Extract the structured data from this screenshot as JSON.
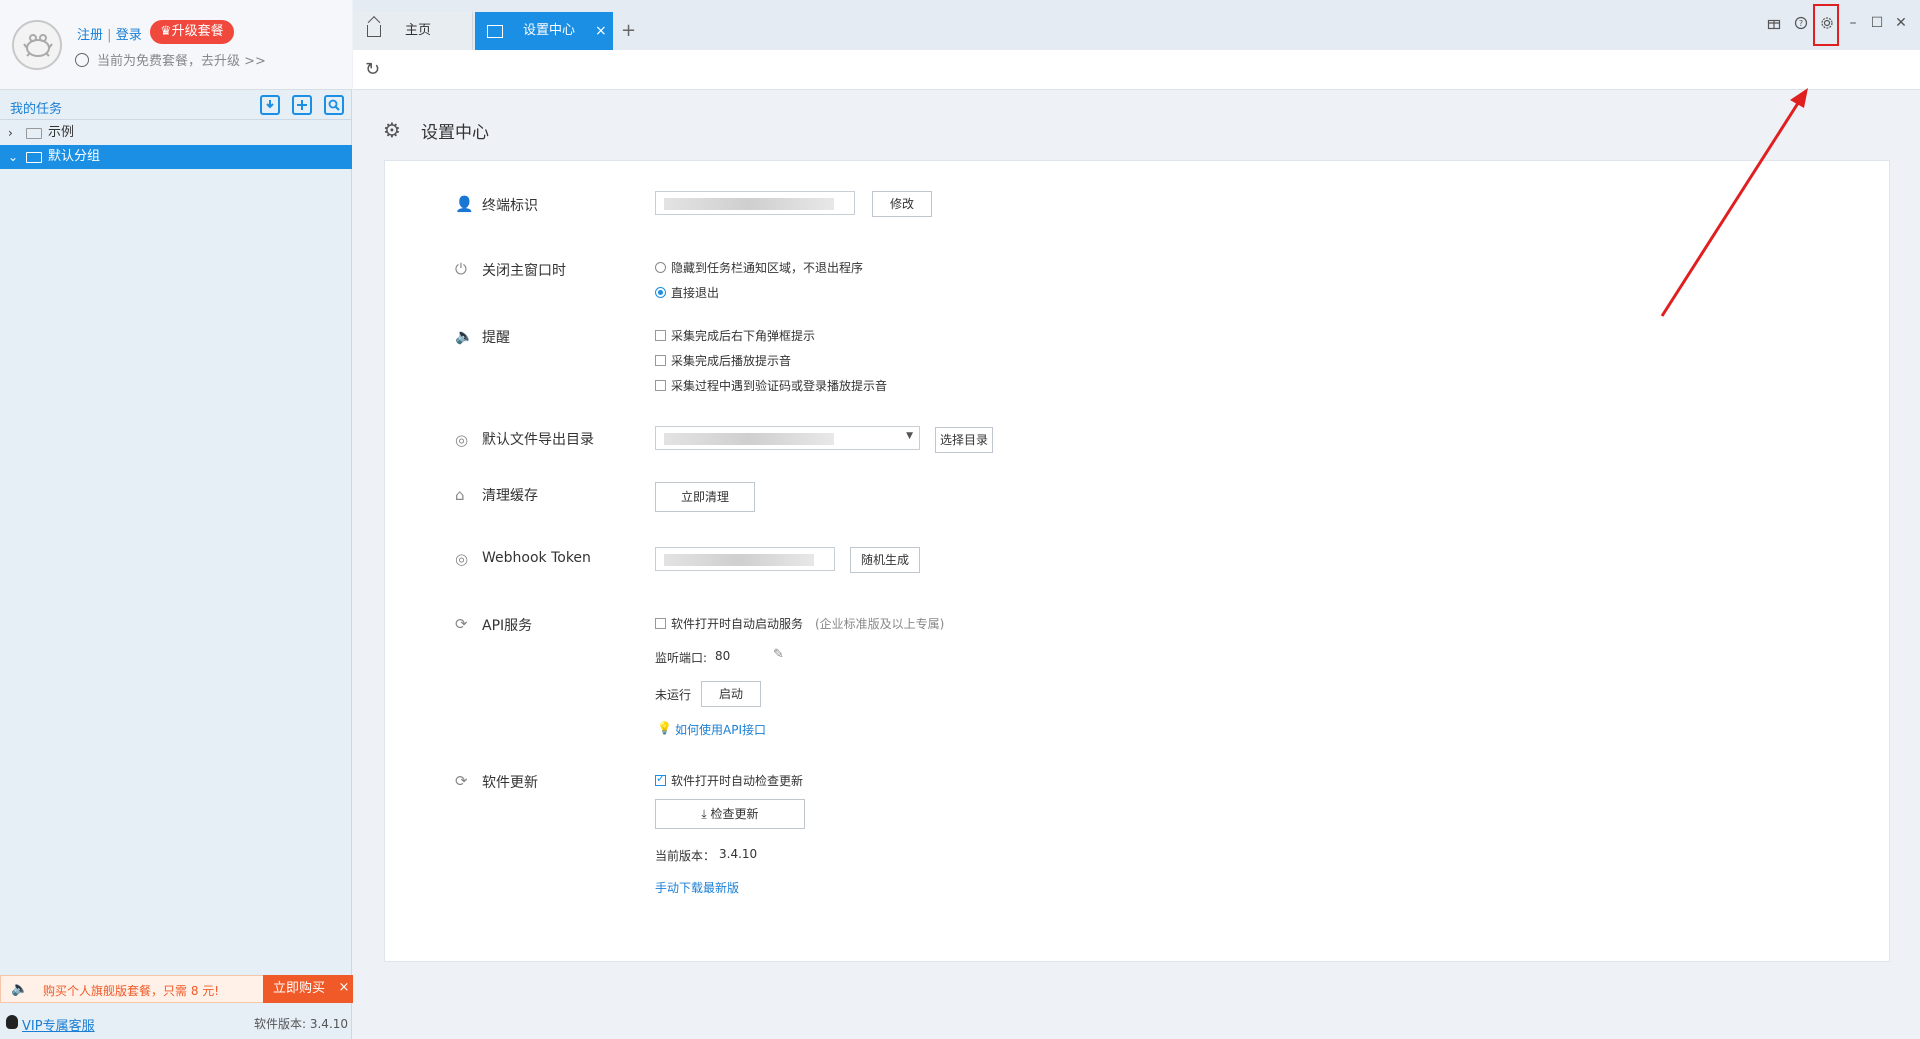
{
  "user": {
    "register": "注册",
    "separator": "|",
    "login": "登录",
    "upgrade_badge": "♛升级套餐",
    "plan_note": "当前为免费套餐，去升级 >>"
  },
  "sidebar": {
    "title": "我的任务",
    "tree": [
      {
        "label": "示例",
        "chevron": "›"
      },
      {
        "label": "默认分组",
        "chevron": "⌄"
      }
    ]
  },
  "promo": {
    "text": "购买个人旗舰版套餐，只需 8 元!",
    "buy": "立即购买",
    "close": "×"
  },
  "footer": {
    "vip": "VIP专属客服",
    "version": "软件版本: 3.4.10"
  },
  "tabs": {
    "home": "主页",
    "settings": "设置中心",
    "close": "×",
    "add": "+"
  },
  "window": {
    "minimize": "–",
    "maximize": "☐",
    "close": "✕",
    "accent": "#1a8fe3",
    "highlight": "#e02020"
  },
  "page": {
    "title": "设置中心"
  },
  "settings": {
    "terminal": {
      "label": "终端标识",
      "button": "修改"
    },
    "close_window": {
      "label": "关闭主窗口时",
      "options": [
        "隐藏到任务栏通知区域，不退出程序",
        "直接退出"
      ]
    },
    "reminder": {
      "label": "提醒",
      "options": [
        "采集完成后右下角弹框提示",
        "采集完成后播放提示音",
        "采集过程中遇到验证码或登录播放提示音"
      ]
    },
    "export_dir": {
      "label": "默认文件导出目录",
      "button": "选择目录"
    },
    "cache": {
      "label": "清理缓存",
      "button": "立即清理"
    },
    "webhook": {
      "label": "Webhook Token",
      "button": "随机生成"
    },
    "api": {
      "label": "API服务",
      "auto_start": "软件打开时自动启动服务",
      "auto_start_note": "(企业标准版及以上专属)",
      "port_label": "监听端口:",
      "port_value": "80",
      "status": "未运行",
      "start_button": "启动",
      "howto": "如何使用API接口"
    },
    "update": {
      "label": "软件更新",
      "auto_check": "软件打开时自动检查更新",
      "check_button": "检查更新",
      "current_label": "当前版本：",
      "current_version": "3.4.10",
      "manual_download": "手动下载最新版"
    }
  }
}
